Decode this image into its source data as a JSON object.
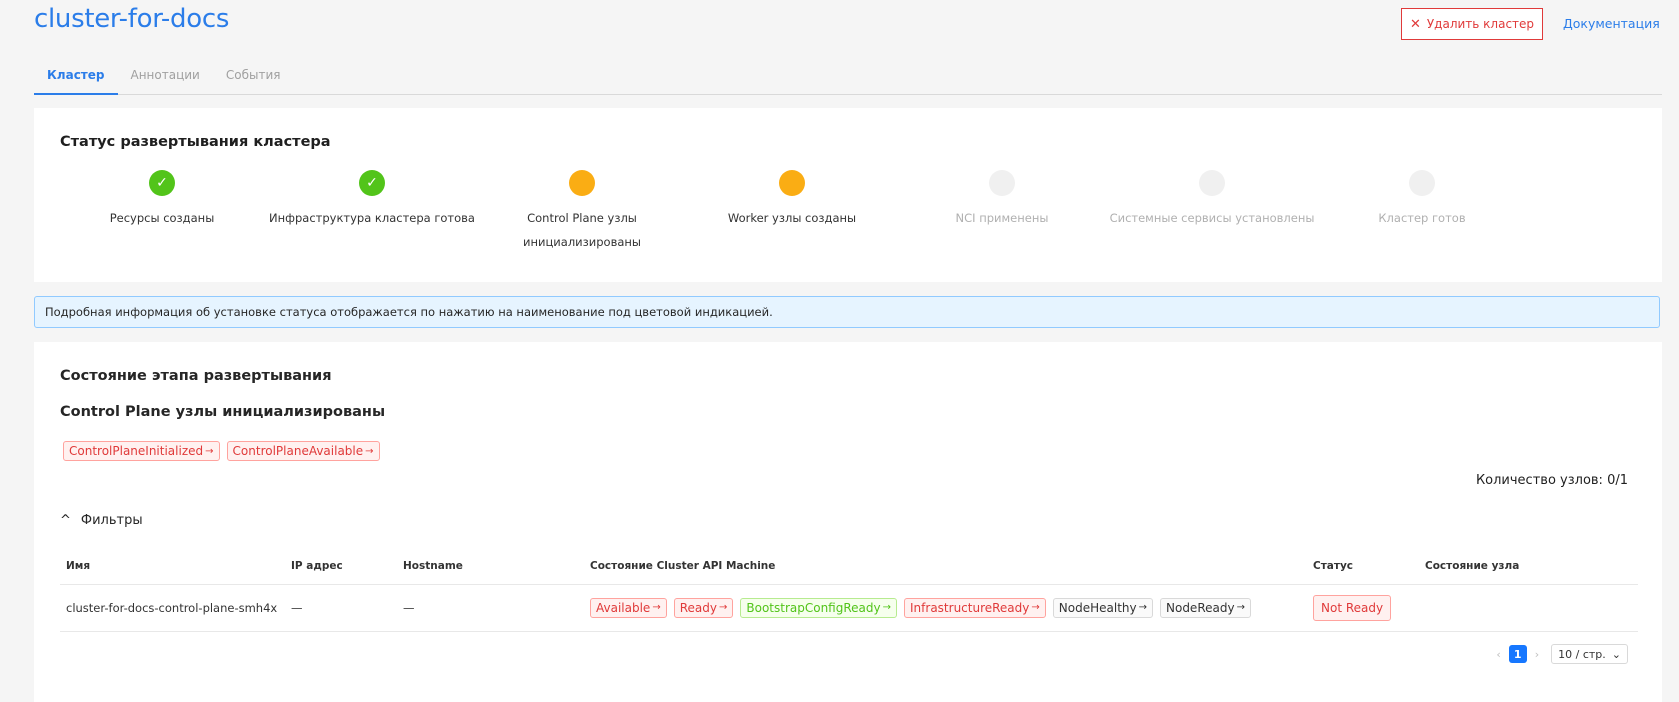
{
  "header": {
    "title": "cluster-for-docs",
    "delete_label": "Удалить кластер",
    "docs_label": "Документация"
  },
  "tabs": [
    {
      "label": "Кластер",
      "active": true
    },
    {
      "label": "Аннотации",
      "active": false
    },
    {
      "label": "События",
      "active": false
    }
  ],
  "deploy_status": {
    "title": "Статус развертывания кластера",
    "steps": [
      {
        "label": "Ресурсы созданы",
        "state": "done"
      },
      {
        "label": "Инфраструктура кластера готова",
        "state": "done"
      },
      {
        "label": "Control Plane узлы инициализированы",
        "state": "in-progress"
      },
      {
        "label": "Worker узлы созданы",
        "state": "in-progress"
      },
      {
        "label": "NCI применены",
        "state": "waiting"
      },
      {
        "label": "Системные сервисы установлены",
        "state": "waiting"
      },
      {
        "label": "Кластер готов",
        "state": "waiting"
      }
    ]
  },
  "info_banner": "Подробная информация об установке статуса отображается по нажатию на наименование под цветовой индикацией.",
  "stage": {
    "title": "Состояние этапа развертывания",
    "subtitle": "Control Plane узлы инициализированы",
    "conditions": [
      "ControlPlaneInitialized",
      "ControlPlaneAvailable"
    ],
    "node_count": "Количество узлов: 0/1",
    "filters_label": "Фильтры"
  },
  "table": {
    "columns": [
      "Имя",
      "IP адрес",
      "Hostname",
      "Состояние Cluster API Machine",
      "Статус",
      "Состояние узла"
    ],
    "rows": [
      {
        "name": "cluster-for-docs-control-plane-smh4x",
        "ip": "—",
        "hostname": "—",
        "machine_conditions": [
          {
            "label": "Available",
            "color": "red"
          },
          {
            "label": "Ready",
            "color": "red"
          },
          {
            "label": "BootstrapConfigReady",
            "color": "green"
          },
          {
            "label": "InfrastructureReady",
            "color": "red"
          },
          {
            "label": "NodeHealthy",
            "color": "gray"
          },
          {
            "label": "NodeReady",
            "color": "gray"
          }
        ],
        "status": "Not Ready",
        "node_state": ""
      }
    ]
  },
  "pagination": {
    "current_page": "1",
    "page_size": "10 / стр."
  },
  "colors": {
    "accent": "#2b7de9",
    "done": "#52c41a",
    "in_progress": "#faad14",
    "danger": "#e03a3a"
  }
}
